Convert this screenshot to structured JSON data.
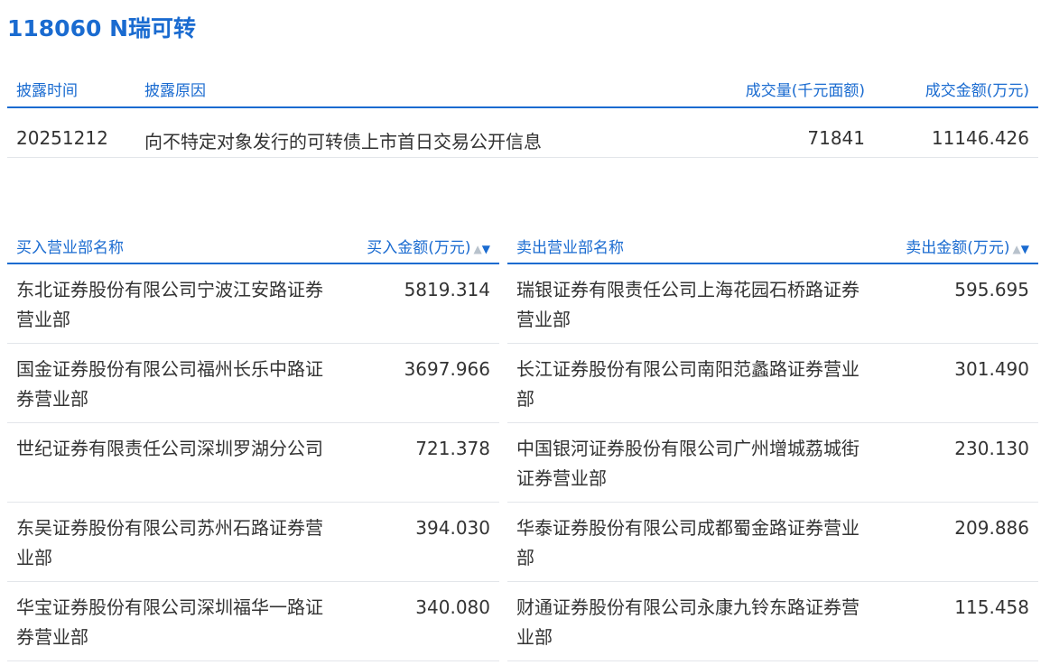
{
  "title": "118060 N瑞可转",
  "disclosure": {
    "headers": {
      "date": "披露时间",
      "reason": "披露原因",
      "volume": "成交量(千元面额)",
      "amount": "成交金额(万元)"
    },
    "row": {
      "date": "20251212",
      "reason": "向不特定对象发行的可转债上市首日交易公开信息",
      "volume": "71841",
      "amount": "11146.426"
    }
  },
  "buy": {
    "headers": {
      "name": "买入营业部名称",
      "amount": "买入金额(万元)"
    },
    "rows": [
      {
        "name": "东北证券股份有限公司宁波江安路证券营业部",
        "amount": "5819.314"
      },
      {
        "name": "国金证券股份有限公司福州长乐中路证券营业部",
        "amount": "3697.966"
      },
      {
        "name": "世纪证券有限责任公司深圳罗湖分公司",
        "amount": "721.378"
      },
      {
        "name": "东吴证券股份有限公司苏州石路证券营业部",
        "amount": "394.030"
      },
      {
        "name": "华宝证券股份有限公司深圳福华一路证券营业部",
        "amount": "340.080"
      }
    ]
  },
  "sell": {
    "headers": {
      "name": "卖出营业部名称",
      "amount": "卖出金额(万元)"
    },
    "rows": [
      {
        "name": "瑞银证券有限责任公司上海花园石桥路证券营业部",
        "amount": "595.695"
      },
      {
        "name": "长江证券股份有限公司南阳范蠡路证券营业部",
        "amount": "301.490"
      },
      {
        "name": "中国银河证券股份有限公司广州增城荔城街证券营业部",
        "amount": "230.130"
      },
      {
        "name": "华泰证券股份有限公司成都蜀金路证券营业部",
        "amount": "209.886"
      },
      {
        "name": "财通证券股份有限公司永康九铃东路证券营业部",
        "amount": "115.458"
      }
    ]
  },
  "sort_glyphs": {
    "up": "▲",
    "down": "▼"
  },
  "colors": {
    "accent": "#1a6bd0",
    "text": "#333333",
    "divider": "#e3e6ea"
  }
}
